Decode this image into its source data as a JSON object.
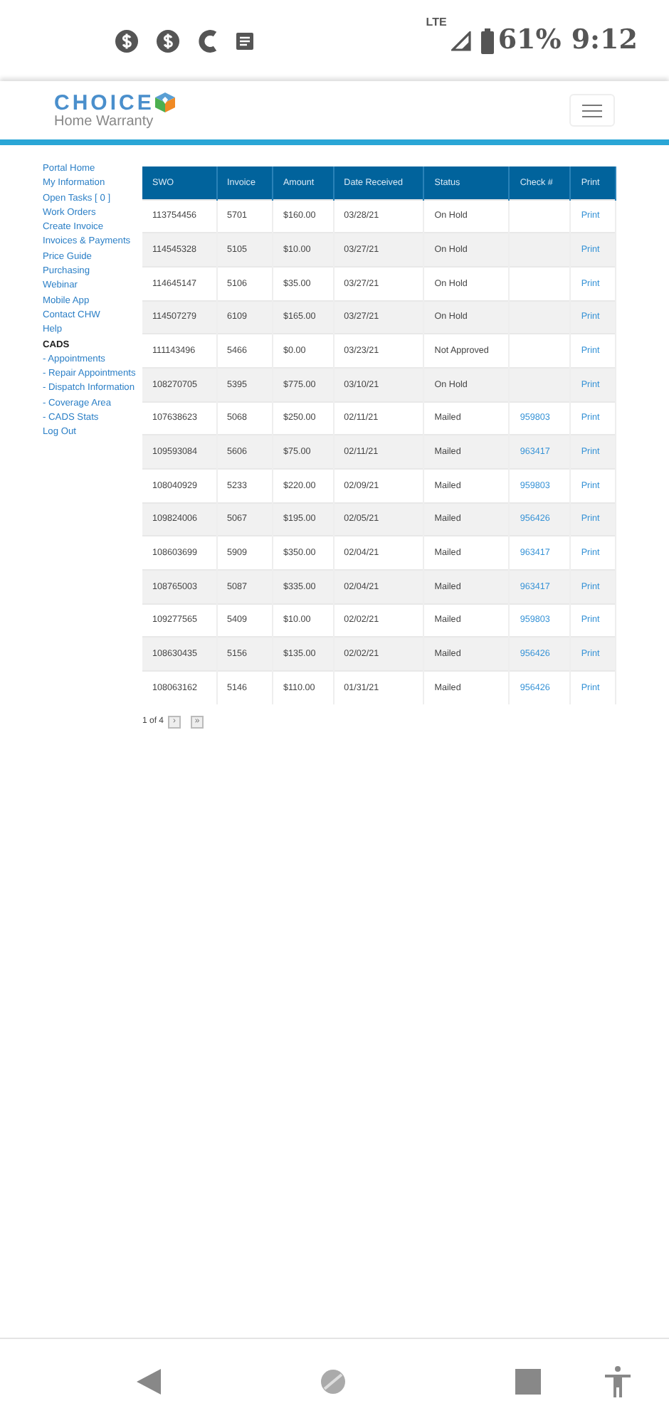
{
  "status_bar": {
    "network": "LTE",
    "battery": "61%",
    "time": "9:12"
  },
  "header": {
    "logo_text": "CHOICE",
    "logo_subtext": "Home Warranty"
  },
  "sidebar": {
    "items": [
      {
        "label": "Portal Home",
        "kind": "link"
      },
      {
        "label": "My Information",
        "kind": "link"
      },
      {
        "label": "Open Tasks [ 0 ]",
        "kind": "link"
      },
      {
        "label": "Work Orders",
        "kind": "link"
      },
      {
        "label": "Create Invoice",
        "kind": "link"
      },
      {
        "label": "Invoices & Payments",
        "kind": "link"
      },
      {
        "label": "Price Guide",
        "kind": "link"
      },
      {
        "label": "Purchasing",
        "kind": "link"
      },
      {
        "label": "Webinar",
        "kind": "link"
      },
      {
        "label": "Mobile App",
        "kind": "link"
      },
      {
        "label": "Contact CHW",
        "kind": "link"
      },
      {
        "label": "Help",
        "kind": "link"
      },
      {
        "label": "CADS",
        "kind": "heading"
      },
      {
        "label": "- Appointments",
        "kind": "link"
      },
      {
        "label": "- Repair Appointments",
        "kind": "link"
      },
      {
        "label": "- Dispatch Information",
        "kind": "link"
      },
      {
        "label": "- Coverage Area",
        "kind": "link"
      },
      {
        "label": "- CADS Stats",
        "kind": "link"
      },
      {
        "label": "Log Out",
        "kind": "link"
      }
    ]
  },
  "table": {
    "columns": [
      "SWO",
      "Invoice",
      "Amount",
      "Date Received",
      "Status",
      "Check #",
      "Print"
    ],
    "rows": [
      [
        "113754456",
        "5701",
        "$160.00",
        "03/28/21",
        "On Hold",
        "",
        "Print"
      ],
      [
        "114545328",
        "5105",
        "$10.00",
        "03/27/21",
        "On Hold",
        "",
        "Print"
      ],
      [
        "114645147",
        "5106",
        "$35.00",
        "03/27/21",
        "On Hold",
        "",
        "Print"
      ],
      [
        "114507279",
        "6109",
        "$165.00",
        "03/27/21",
        "On Hold",
        "",
        "Print"
      ],
      [
        "111143496",
        "5466",
        "$0.00",
        "03/23/21",
        "Not Approved",
        "",
        "Print"
      ],
      [
        "108270705",
        "5395",
        "$775.00",
        "03/10/21",
        "On Hold",
        "",
        "Print"
      ],
      [
        "107638623",
        "5068",
        "$250.00",
        "02/11/21",
        "Mailed",
        "959803",
        "Print"
      ],
      [
        "109593084",
        "5606",
        "$75.00",
        "02/11/21",
        "Mailed",
        "963417",
        "Print"
      ],
      [
        "108040929",
        "5233",
        "$220.00",
        "02/09/21",
        "Mailed",
        "959803",
        "Print"
      ],
      [
        "109824006",
        "5067",
        "$195.00",
        "02/05/21",
        "Mailed",
        "956426",
        "Print"
      ],
      [
        "108603699",
        "5909",
        "$350.00",
        "02/04/21",
        "Mailed",
        "963417",
        "Print"
      ],
      [
        "108765003",
        "5087",
        "$335.00",
        "02/04/21",
        "Mailed",
        "963417",
        "Print"
      ],
      [
        "109277565",
        "5409",
        "$10.00",
        "02/02/21",
        "Mailed",
        "959803",
        "Print"
      ],
      [
        "108630435",
        "5156",
        "$135.00",
        "02/02/21",
        "Mailed",
        "956426",
        "Print"
      ],
      [
        "108063162",
        "5146",
        "$110.00",
        "01/31/21",
        "Mailed",
        "956426",
        "Print"
      ]
    ]
  },
  "pagination": {
    "label": "1 of 4",
    "next": "›",
    "last": "»"
  }
}
